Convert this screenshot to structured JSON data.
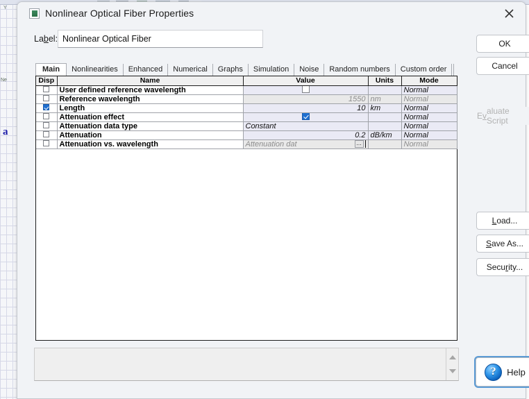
{
  "window": {
    "title": "Nonlinear Optical Fiber Properties",
    "icon": "component-icon",
    "close_icon": "close-icon"
  },
  "label_field": {
    "caption_before": "La",
    "caption_accel": "b",
    "caption_after": "el:",
    "value": "Nonlinear Optical Fiber"
  },
  "tabs": [
    {
      "label": "Main",
      "active": true
    },
    {
      "label": "Nonlinearities",
      "active": false
    },
    {
      "label": "Enhanced",
      "active": false
    },
    {
      "label": "Numerical",
      "active": false
    },
    {
      "label": "Graphs",
      "active": false
    },
    {
      "label": "Simulation",
      "active": false
    },
    {
      "label": "Noise",
      "active": false
    },
    {
      "label": "Random numbers",
      "active": false
    },
    {
      "label": "Custom order",
      "active": false
    }
  ],
  "table": {
    "columns": [
      "Disp",
      "Name",
      "Value",
      "Units",
      "Mode"
    ],
    "rows": [
      {
        "disp": false,
        "name": "User defined reference wavelength",
        "value": "",
        "value_type": "checkbox",
        "value_checked": false,
        "units": "",
        "mode": "Normal",
        "enabled": true
      },
      {
        "disp": false,
        "name": "Reference wavelength",
        "value": "1550",
        "value_type": "number",
        "units": "nm",
        "mode": "Normal",
        "enabled": false
      },
      {
        "disp": true,
        "name": "Length",
        "value": "10",
        "value_type": "number",
        "units": "km",
        "mode": "Normal",
        "enabled": true
      },
      {
        "disp": false,
        "name": "Attenuation effect",
        "value": "",
        "value_type": "checkbox",
        "value_checked": true,
        "units": "",
        "mode": "Normal",
        "enabled": true
      },
      {
        "disp": false,
        "name": "Attenuation data type",
        "value": "Constant",
        "value_type": "text",
        "units": "",
        "mode": "Normal",
        "enabled": true
      },
      {
        "disp": false,
        "name": "Attenuation",
        "value": "0.2",
        "value_type": "number",
        "units": "dB/km",
        "mode": "Normal",
        "enabled": true
      },
      {
        "disp": false,
        "name": "Attenuation vs. wavelength",
        "value": "Attenuation dat",
        "value_type": "file",
        "units": "",
        "mode": "Normal",
        "enabled": false
      }
    ]
  },
  "description_panel": {
    "text": ""
  },
  "buttons": {
    "ok": {
      "label": "OK",
      "accel": "",
      "enabled": true
    },
    "cancel": {
      "label": "Cancel",
      "accel": "",
      "enabled": true
    },
    "evaluate": {
      "before": "E",
      "accel": "v",
      "after": "aluate Script",
      "enabled": false
    },
    "load": {
      "before": "",
      "accel": "L",
      "after": "oad...",
      "enabled": true
    },
    "save_as": {
      "before": "",
      "accel": "S",
      "after": "ave As...",
      "enabled": true
    },
    "security": {
      "before": "Secu",
      "accel": "r",
      "after": "ity...",
      "enabled": true
    },
    "help": {
      "label": "Help",
      "icon": "help-question-icon",
      "enabled": true
    }
  },
  "colors": {
    "accent": "#1f6fd0",
    "dialog_bg": "#f1f3f6",
    "value_cell": "#eaeaf5",
    "disabled_cell": "#e9e9e9",
    "focus_ring": "#5b9bd5"
  },
  "background_app": {
    "marker": "a"
  }
}
